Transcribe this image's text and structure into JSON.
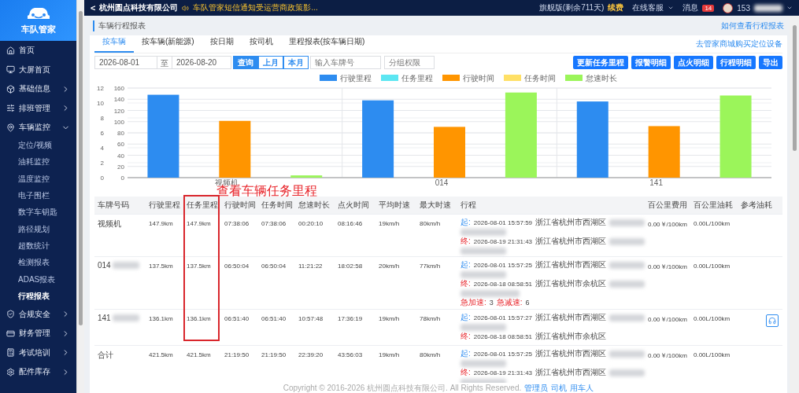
{
  "brand": {
    "name": "车队管家"
  },
  "sidebar": {
    "items": [
      {
        "label": "首页"
      },
      {
        "label": "大屏首页"
      },
      {
        "label": "基础信息",
        "expanded": false
      },
      {
        "label": "排班管理",
        "expanded": false
      },
      {
        "label": "车辆监控",
        "expanded": true,
        "children": [
          {
            "label": "定位/视频",
            "selected": false
          },
          {
            "label": "油耗监控",
            "selected": false
          },
          {
            "label": "温度监控",
            "selected": false
          },
          {
            "label": "电子围栏",
            "selected": false
          },
          {
            "label": "数字车钥匙",
            "selected": false
          },
          {
            "label": "路径规划",
            "selected": false
          },
          {
            "label": "超数统计",
            "selected": false
          },
          {
            "label": "检测报表",
            "selected": false
          },
          {
            "label": "ADAS报表",
            "selected": false
          },
          {
            "label": "行程报表",
            "selected": true
          }
        ]
      },
      {
        "label": "合规安全",
        "expanded": false
      },
      {
        "label": "财务管理",
        "expanded": false
      },
      {
        "label": "考试培训",
        "expanded": false
      },
      {
        "label": "配件库存",
        "expanded": false
      }
    ]
  },
  "topbar": {
    "back": "<",
    "company": "杭州圆点科技有限公司",
    "notice": "车队管家短信通知受运营商政策影...",
    "plan": "旗舰版(剩余711天)",
    "renew": "续费",
    "service": "在线客服",
    "messages": "消息",
    "message_count": "14",
    "user": "153",
    "user_redacted": true
  },
  "page": {
    "title": "车辆行程报表",
    "help_link": "如何查看行程报表"
  },
  "tabs": [
    {
      "label": "按车辆",
      "selected": true
    },
    {
      "label": "按车辆(新能源)",
      "selected": false
    },
    {
      "label": "按日期",
      "selected": false
    },
    {
      "label": "按司机",
      "selected": false
    },
    {
      "label": "里程报表(按车辆日期)",
      "selected": false
    }
  ],
  "shop_link": "去管家商城购买定位设备",
  "filters": {
    "start": "2026-08-01",
    "separator": "至",
    "end": "2026-08-20",
    "query": "查询",
    "ranges": [
      {
        "label": "上月",
        "selected": false
      },
      {
        "label": "本月",
        "selected": false
      }
    ],
    "plate_placeholder": "输入车牌号",
    "group_placeholder": "分组权限"
  },
  "actions": [
    "更新任务里程",
    "报警明细",
    "点火明细",
    "行程明细",
    "导出"
  ],
  "chart": {
    "chart_data": {
      "type": "bar",
      "grid": true,
      "legend": true,
      "categories": [
        "视频机",
        "014",
        "141"
      ],
      "ylim": [
        0,
        12
      ],
      "yticks": [
        0,
        2,
        4,
        6,
        8,
        10,
        12
      ],
      "y2lim": [
        0,
        160
      ],
      "y2ticks": [
        0,
        20,
        40,
        60,
        80,
        100,
        120,
        140,
        160
      ],
      "series": [
        {
          "name": "行驶里程",
          "color": "#2d8cf0",
          "axis": "y2",
          "values": [
            148,
            138,
            136
          ]
        },
        {
          "name": "任务里程",
          "color": "#5ce6f2",
          "values": [
            null,
            null,
            null
          ]
        },
        {
          "name": "行驶时间",
          "color": "#ff9500",
          "values": [
            7.6,
            6.8,
            6.9
          ]
        },
        {
          "name": "任务时间",
          "color": "#ffe066",
          "values": [
            null,
            null,
            null
          ]
        },
        {
          "name": "怠速时长",
          "color": "#9bf55a",
          "values": [
            0.3,
            11.4,
            11.0
          ]
        }
      ]
    }
  },
  "annotation": {
    "text": "查看车辆任务里程"
  },
  "table": {
    "columns": [
      {
        "label": "车牌号码",
        "highlighted": false
      },
      {
        "label": "行驶里程",
        "highlighted": false
      },
      {
        "label": "任务里程",
        "highlighted": true
      },
      {
        "label": "行驶时间",
        "highlighted": false
      },
      {
        "label": "任务时间",
        "highlighted": false
      },
      {
        "label": "怠速时长",
        "highlighted": false
      },
      {
        "label": "点火时间",
        "highlighted": false
      },
      {
        "label": "平均时速",
        "highlighted": false
      },
      {
        "label": "最大时速",
        "highlighted": false
      },
      {
        "label": "行程",
        "highlighted": false
      },
      {
        "label": "百公里费用",
        "highlighted": false
      },
      {
        "label": "百公里油耗",
        "highlighted": false
      },
      {
        "label": "参考油耗",
        "highlighted": false
      }
    ],
    "rows": [
      {
        "redacted": false,
        "highlighted": true,
        "cells": [
          "视频机",
          "147.9km",
          "147.9km",
          "07:38:06",
          "07:38:06",
          "00:20:10",
          "08:16:46",
          "19km/h",
          "80km/h"
        ],
        "trip": [
          {
            "kind": "start",
            "label": "起:",
            "time": "2026-08-01 15:57:59",
            "place": "浙江省杭州市西湖区",
            "redacted": true
          },
          {
            "kind": "end",
            "label": "终:",
            "time": "2026-08-19 21:31:43",
            "place": "浙江省杭州市西湖区",
            "redacted": true
          }
        ],
        "cost": "0.00￥/100km",
        "fuel": "0.00L/100km"
      },
      {
        "redacted": true,
        "highlighted": true,
        "cells": [
          "014",
          "137.5km",
          "137.5km",
          "06:50:04",
          "06:50:04",
          "11:21:22",
          "18:02:58",
          "20km/h",
          "77km/h"
        ],
        "trip": [
          {
            "kind": "start",
            "label": "起:",
            "time": "2026-08-01 15:57:25",
            "place": "浙江省杭州市西湖区",
            "redacted": true
          },
          {
            "kind": "end",
            "label": "终:",
            "time": "2026-08-18 08:58:51",
            "place": "浙江省杭州市余杭区",
            "redacted": true
          }
        ],
        "events": [
          {
            "label": "急加速:",
            "count": "3"
          },
          {
            "label": "急减速:",
            "count": "6"
          }
        ],
        "cost": "0.00￥/100km",
        "fuel": "0.00L/100km"
      },
      {
        "redacted": true,
        "highlighted": true,
        "cells": [
          "141",
          "136.1km",
          "136.1km",
          "06:51:40",
          "06:51:40",
          "10:57:48",
          "17:36:19",
          "19km/h",
          "78km/h"
        ],
        "trip": [
          {
            "kind": "start",
            "label": "起:",
            "time": "2026-08-01 15:57:27",
            "place": "浙江省杭州市西湖区",
            "redacted": true
          },
          {
            "kind": "end",
            "label": "终:",
            "time": "2026-08-18 08:58:51",
            "place": "浙江省杭州市余杭区",
            "redacted": false
          }
        ],
        "cost": "0.00￥/100km",
        "fuel": "0.00L/100km",
        "audio_button": true
      },
      {
        "redacted": false,
        "highlighted": false,
        "cells": [
          "合计",
          "421.5km",
          "421.5km",
          "21:19:50",
          "21:19:50",
          "22:39:20",
          "43:56:03",
          "19km/h",
          "80km/h"
        ],
        "trip": [
          {
            "kind": "start",
            "label": "起:",
            "time": "2026-08-01 15:57:25",
            "place": "浙江省杭州市西湖区",
            "redacted": true
          },
          {
            "kind": "end",
            "label": "终:",
            "time": "2026-08-19 21:31:43",
            "place": "浙江省杭州市西湖区",
            "redacted": true
          }
        ],
        "cost": "0.00￥/100km",
        "fuel": "0.00L/100km"
      }
    ]
  },
  "footer": {
    "copyright": "Copyright © 2016-2026 杭州圆点科技有限公司. All Rights Reserved.",
    "links": [
      "管理员",
      "司机",
      "用车人"
    ]
  }
}
